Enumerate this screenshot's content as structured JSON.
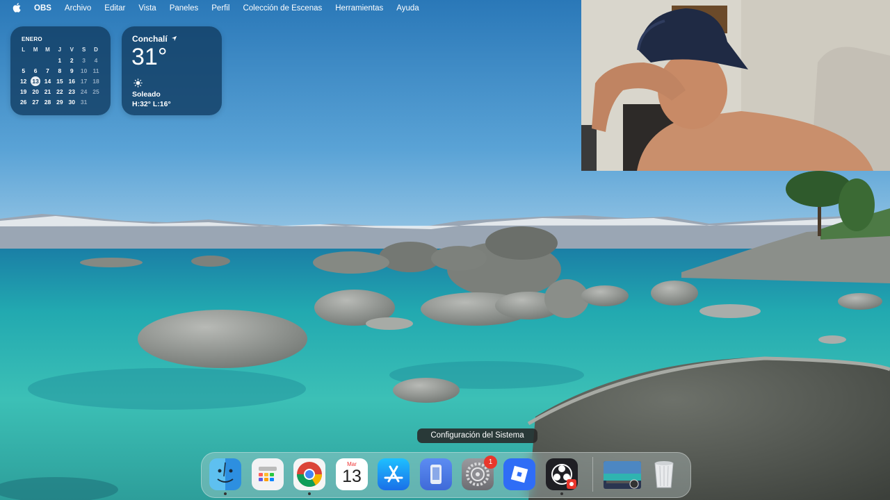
{
  "menubar": {
    "app_name": "OBS",
    "items": [
      "Archivo",
      "Editar",
      "Vista",
      "Paneles",
      "Perfil",
      "Colección de Escenas",
      "Herramientas",
      "Ayuda"
    ],
    "apple_icon": "apple-logo-icon"
  },
  "calendar_widget": {
    "month": "ENERO",
    "weekdays": [
      "L",
      "M",
      "M",
      "J",
      "V",
      "S",
      "D"
    ],
    "weeks": [
      [
        "",
        "",
        "",
        "1",
        "2",
        "3",
        "4"
      ],
      [
        "5",
        "6",
        "7",
        "8",
        "9",
        "10",
        "11"
      ],
      [
        "12",
        "13",
        "14",
        "15",
        "16",
        "17",
        "18"
      ],
      [
        "19",
        "20",
        "21",
        "22",
        "23",
        "24",
        "25"
      ],
      [
        "26",
        "27",
        "28",
        "29",
        "30",
        "31",
        ""
      ]
    ],
    "today": "13"
  },
  "weather_widget": {
    "city": "Conchalí",
    "temperature": "31°",
    "condition": "Soleado",
    "high_low": "H:32° L:16°",
    "icon": "sun-icon"
  },
  "dock": {
    "tooltip": "Configuración del Sistema",
    "calendar_icon_month": "Mar",
    "calendar_icon_day": "13",
    "settings_badge": "1",
    "apps": [
      "finder-icon",
      "launchpad-icon",
      "chrome-icon",
      "calendar-icon",
      "app-store-icon",
      "simulator-icon",
      "system-settings-icon",
      "roblox-icon",
      "obs-icon",
      "screenshot-thumbnail-icon",
      "trash-icon"
    ]
  },
  "colors": {
    "widget_bg": "#123e64",
    "sky_top": "#2a78b8",
    "water": "#2fb4b0",
    "badge": "#e8362c"
  }
}
